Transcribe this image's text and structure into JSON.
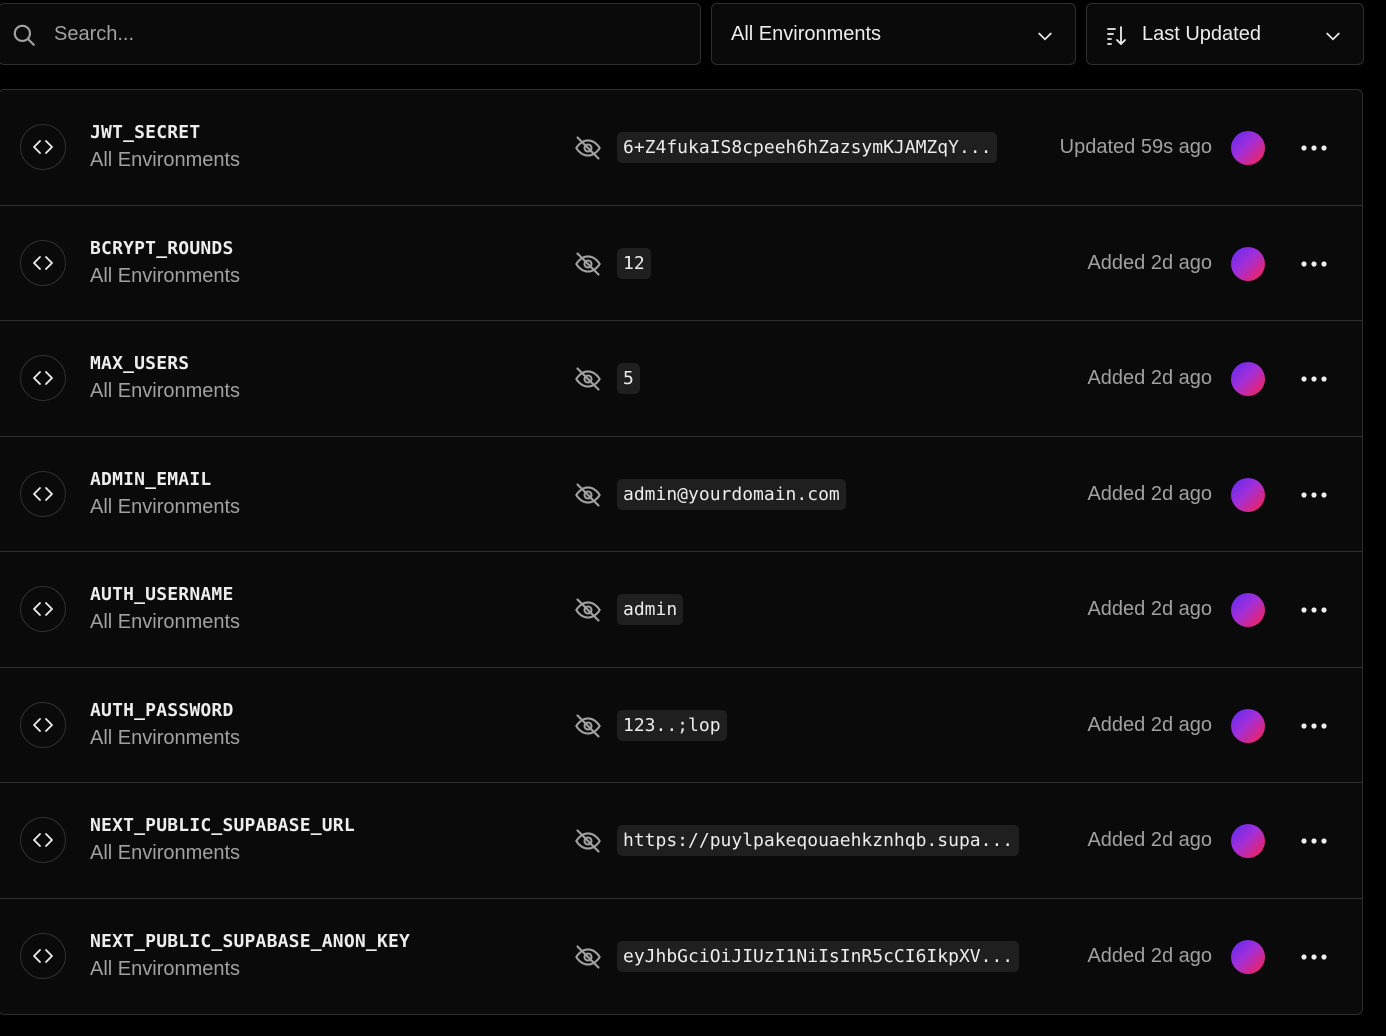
{
  "search": {
    "placeholder": "Search..."
  },
  "env_filter": {
    "selected": "All Environments"
  },
  "sort": {
    "selected": "Last Updated"
  },
  "colors": {
    "background": "#000000",
    "surface": "#0a0a0a",
    "border": "#2e2e2e",
    "muted_text": "#a1a1a1",
    "value_bg": "#1f1f1f"
  },
  "variables": [
    {
      "name": "JWT_SECRET",
      "environment": "All Environments",
      "value": "6+Z4fukaIS8cpeeh6hZazsymKJAMZqY...",
      "status": "Updated 59s ago"
    },
    {
      "name": "BCRYPT_ROUNDS",
      "environment": "All Environments",
      "value": "12",
      "status": "Added 2d ago"
    },
    {
      "name": "MAX_USERS",
      "environment": "All Environments",
      "value": "5",
      "status": "Added 2d ago"
    },
    {
      "name": "ADMIN_EMAIL",
      "environment": "All Environments",
      "value": "admin@yourdomain.com",
      "status": "Added 2d ago"
    },
    {
      "name": "AUTH_USERNAME",
      "environment": "All Environments",
      "value": "admin",
      "status": "Added 2d ago"
    },
    {
      "name": "AUTH_PASSWORD",
      "environment": "All Environments",
      "value": "123..;lop",
      "status": "Added 2d ago"
    },
    {
      "name": "NEXT_PUBLIC_SUPABASE_URL",
      "environment": "All Environments",
      "value": "https://puylpakeqouaehkznhqb.supa...",
      "status": "Added 2d ago"
    },
    {
      "name": "NEXT_PUBLIC_SUPABASE_ANON_KEY",
      "environment": "All Environments",
      "value": "eyJhbGciOiJIUzI1NiIsInR5cCI6IkpXV...",
      "status": "Added 2d ago"
    }
  ],
  "icons": {
    "search": "search-icon",
    "chevron": "chevron-down-icon",
    "sort": "sort-descending-icon",
    "code": "code-icon",
    "eye_off": "eye-off-icon",
    "more": "more-horizontal-icon"
  }
}
